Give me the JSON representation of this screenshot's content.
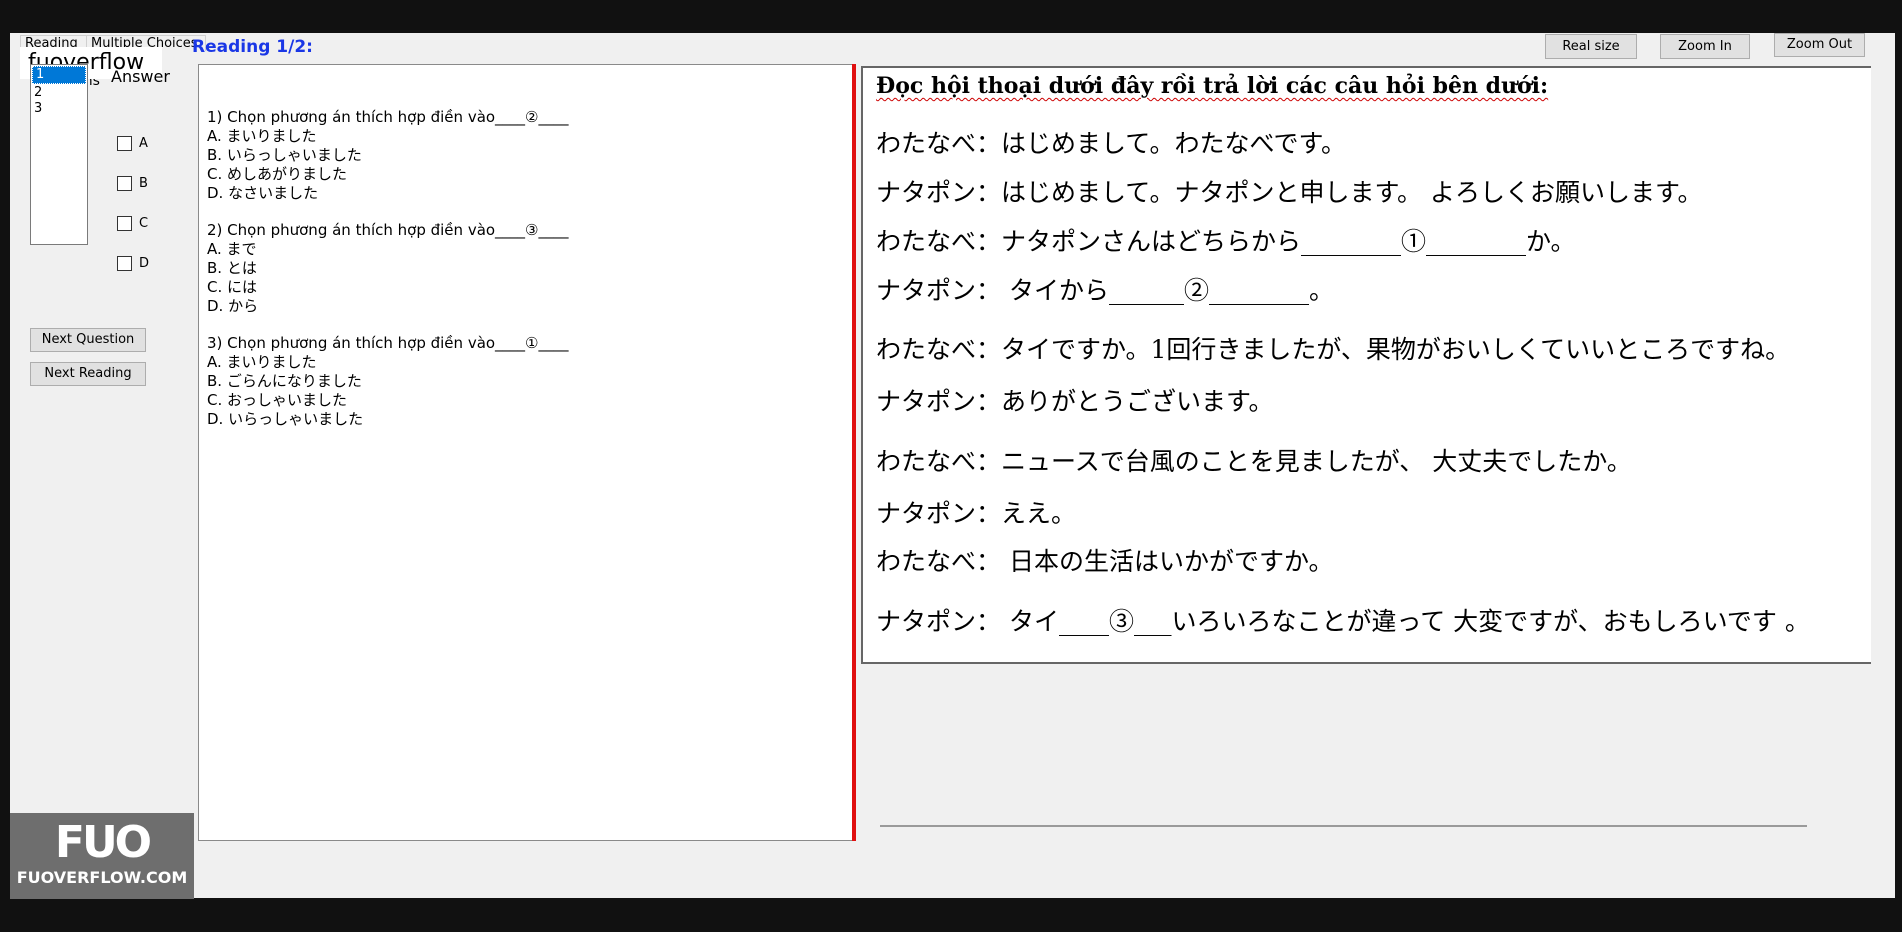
{
  "tabs": [
    "Reading",
    "Multiple Choices"
  ],
  "brand": "fuoverflow",
  "questions_label": "Questions",
  "reading_title": "Reading 1/2:",
  "question_list": [
    "1",
    "2",
    "3"
  ],
  "answer_label": "Answer",
  "options": [
    "A",
    "B",
    "C",
    "D"
  ],
  "buttons": {
    "next_question": "Next Question",
    "next_reading": "Next Reading",
    "real_size": "Real size",
    "zoom_in": "Zoom In",
    "zoom_out": "Zoom Out"
  },
  "questions": [
    {
      "prompt": "1) Chọn phương án thích hợp điền vào____②____",
      "choices": [
        "A. まいりました",
        "B. いらっしゃいました",
        "C. めしあがりました",
        "D. なさいました"
      ]
    },
    {
      "prompt": "2) Chọn phương án thích hợp điền vào____③____",
      "choices": [
        "A. まで",
        "B. とは",
        "C. には",
        "D. から"
      ]
    },
    {
      "prompt": "3) Chọn phương án thích hợp điền vào____①____",
      "choices": [
        "A. まいりました",
        "B. ごらんになりました",
        "C. おっしゃいました",
        "D. いらっしゃいました"
      ]
    }
  ],
  "reading": {
    "title": "Đọc hội thoại dưới đây rồi trả lời các câu hỏi bên dưới:",
    "lines": [
      "わたなべ：はじめまして。わたなべです。",
      "ナタポン：はじめまして。ナタポンと申します。 よろしくお願いします。",
      "わたなべ：ナタポンさんはどちらから________①________か。",
      "ナタポン： タイから______②________。",
      "わたなべ：タイですか。1回行きましたが、果物がおいしくていいところですね。",
      " ナタポン：ありがとうございます。",
      "わたなべ：ニュースで台風のことを見ましたが、 大丈夫でしたか。",
      "ナタポン：ええ。",
      "わたなべ： 日本の生活はいかがですか。",
      "ナタポン： タイ____③___いろいろなことが違って 大変ですが、おもしろいです 。"
    ]
  },
  "logo": {
    "mark": "FUO",
    "text": "FUOVERFLOW.COM"
  }
}
